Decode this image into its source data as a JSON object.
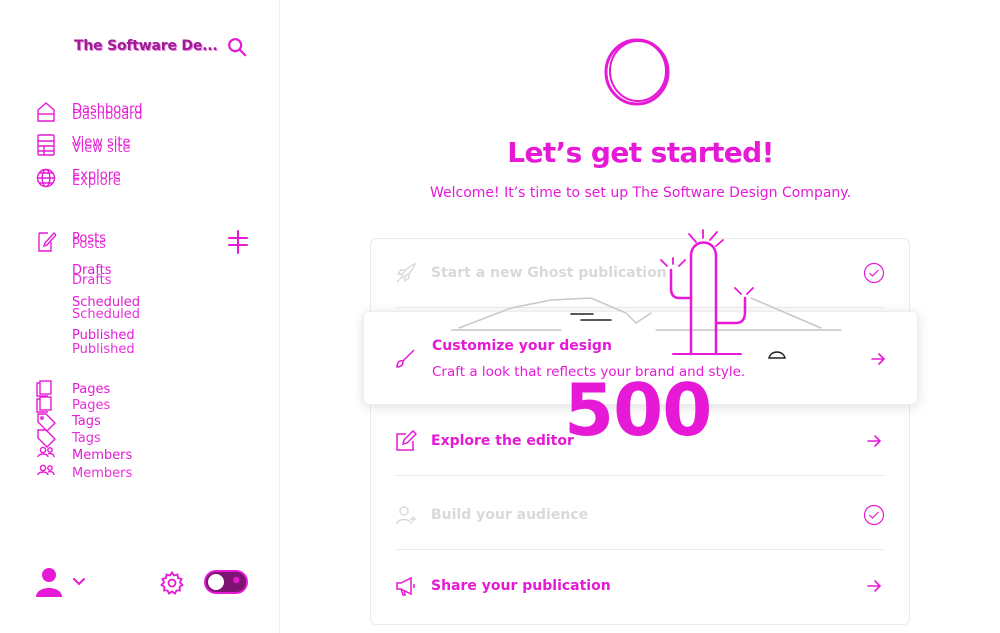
{
  "sidebar": {
    "site_title": "The Software De...",
    "nav": {
      "dashboard": "Dashboard",
      "view_site": "View site",
      "explore": "Explore",
      "posts": "Posts",
      "drafts": "Drafts",
      "scheduled": "Scheduled",
      "published": "Published",
      "pages": "Pages",
      "tags": "Tags",
      "members": "Members"
    },
    "icons": [
      "search-icon",
      "home-icon",
      "view-site-icon",
      "globe-icon",
      "posts-icon",
      "plus-icon",
      "pages-icon",
      "tag-icon",
      "members-icon",
      "avatar",
      "chevron-down-icon",
      "gear-icon",
      "theme-toggle"
    ]
  },
  "main": {
    "headline": "Let’s get started!",
    "subline": "Welcome! It’s time to set up The Software Design Company.",
    "steps": [
      {
        "title": "Start a new Ghost publication",
        "state": "done",
        "icon": "rocket-icon"
      },
      {
        "title": "Customize your design",
        "description": "Craft a look that reflects your brand and style.",
        "state": "active",
        "icon": "paintbrush-icon"
      },
      {
        "title": "Explore the editor",
        "state": "todo",
        "icon": "edit-icon"
      },
      {
        "title": "Build your audience",
        "state": "done",
        "icon": "user-add-icon"
      },
      {
        "title": "Share your publication",
        "state": "todo",
        "icon": "megaphone-icon"
      }
    ],
    "error_code": "500"
  },
  "colors": {
    "accent": "#e619d6",
    "accent_dark": "#9a1f92",
    "done_text": "#d9d9d9",
    "border": "#ececec"
  }
}
